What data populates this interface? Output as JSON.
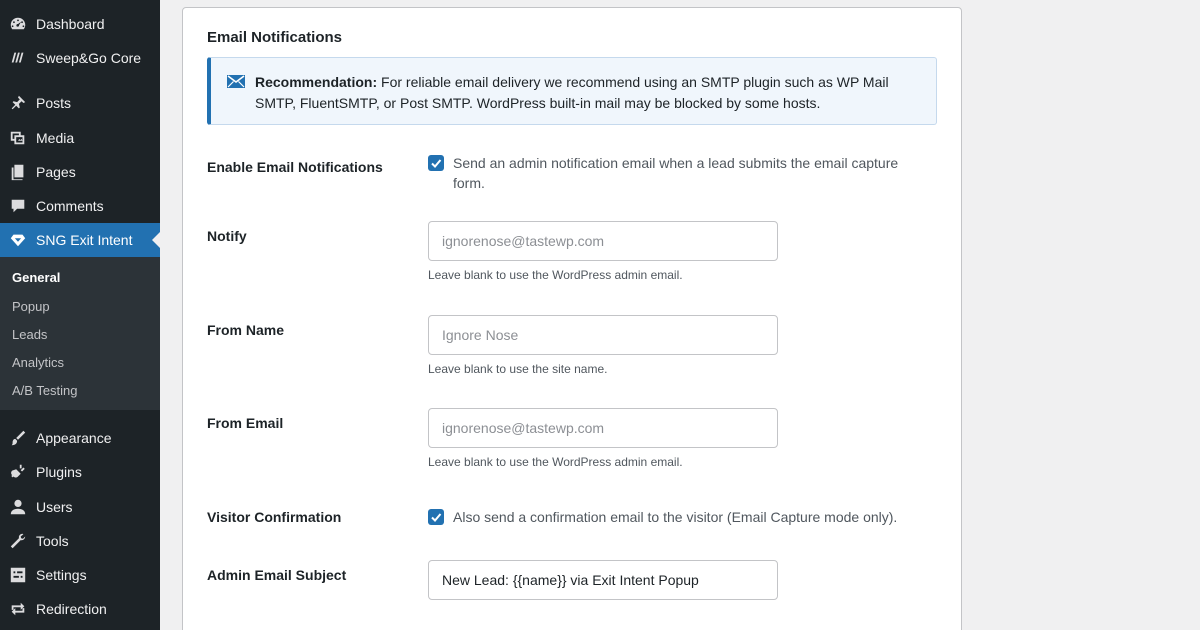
{
  "sidebar": {
    "items": [
      {
        "label": "Dashboard",
        "icon": "dashboard-icon"
      },
      {
        "label": "Sweep&Go Core",
        "icon": "sweepgo-icon"
      },
      {
        "label": "Posts",
        "icon": "pin-icon"
      },
      {
        "label": "Media",
        "icon": "media-icon"
      },
      {
        "label": "Pages",
        "icon": "pages-icon"
      },
      {
        "label": "Comments",
        "icon": "comment-icon"
      },
      {
        "label": "SNG Exit Intent",
        "icon": "diamond-icon"
      },
      {
        "label": "Appearance",
        "icon": "brush-icon"
      },
      {
        "label": "Plugins",
        "icon": "plug-icon"
      },
      {
        "label": "Users",
        "icon": "user-icon"
      },
      {
        "label": "Tools",
        "icon": "wrench-icon"
      },
      {
        "label": "Settings",
        "icon": "settings-icon"
      },
      {
        "label": "Redirection",
        "icon": "redirect-icon"
      }
    ],
    "submenu": [
      "General",
      "Popup",
      "Leads",
      "Analytics",
      "A/B Testing"
    ]
  },
  "card": {
    "title": "Email Notifications",
    "notice": {
      "strong": "Recommendation:",
      "text": " For reliable email delivery we recommend using an SMTP plugin such as WP Mail SMTP, FluentSMTP, or Post SMTP. WordPress built-in mail may be blocked by some hosts."
    },
    "enable": {
      "label": "Enable Email Notifications",
      "checked": true,
      "text": "Send an admin notification email when a lead submits the email capture form."
    },
    "notify": {
      "label": "Notify",
      "placeholder": "ignorenose@tastewp.com",
      "value": "",
      "help": "Leave blank to use the WordPress admin email."
    },
    "from_name": {
      "label": "From Name",
      "placeholder": "Ignore Nose",
      "value": "",
      "help": "Leave blank to use the site name."
    },
    "from_email": {
      "label": "From Email",
      "placeholder": "ignorenose@tastewp.com",
      "value": "",
      "help": "Leave blank to use the WordPress admin email."
    },
    "visitor": {
      "label": "Visitor Confirmation",
      "checked": true,
      "text": "Also send a confirmation email to the visitor (Email Capture mode only)."
    },
    "subject": {
      "label": "Admin Email Subject",
      "value": "New Lead: {{name}} via Exit Intent Popup"
    }
  },
  "colors": {
    "sidebar_bg": "#1d2327",
    "accent": "#2271b1",
    "notice_bg": "#f0f6fc"
  }
}
